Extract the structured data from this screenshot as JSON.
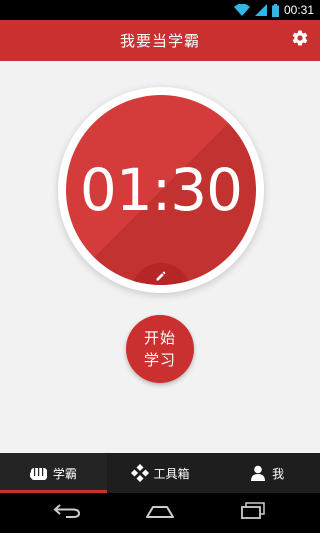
{
  "status_bar": {
    "time": "00:31",
    "icons": [
      "wifi-icon",
      "cell-signal-icon",
      "battery-icon"
    ]
  },
  "header": {
    "title": "我要当学霸",
    "settings_icon": "gear-icon"
  },
  "timer": {
    "display": "01:30",
    "edit_icon": "pencil-icon"
  },
  "start_button": {
    "line1": "开始",
    "line2": "学习"
  },
  "tabs": [
    {
      "label": "学霸",
      "icon": "fist-icon",
      "active": true
    },
    {
      "label": "工具箱",
      "icon": "diamond-grid-icon",
      "active": false
    },
    {
      "label": "我",
      "icon": "person-icon",
      "active": false
    }
  ],
  "colors": {
    "accent": "#c9302f",
    "timer_light": "#d43c3b",
    "timer_dark": "#c23231",
    "background": "#f2f2f2"
  }
}
